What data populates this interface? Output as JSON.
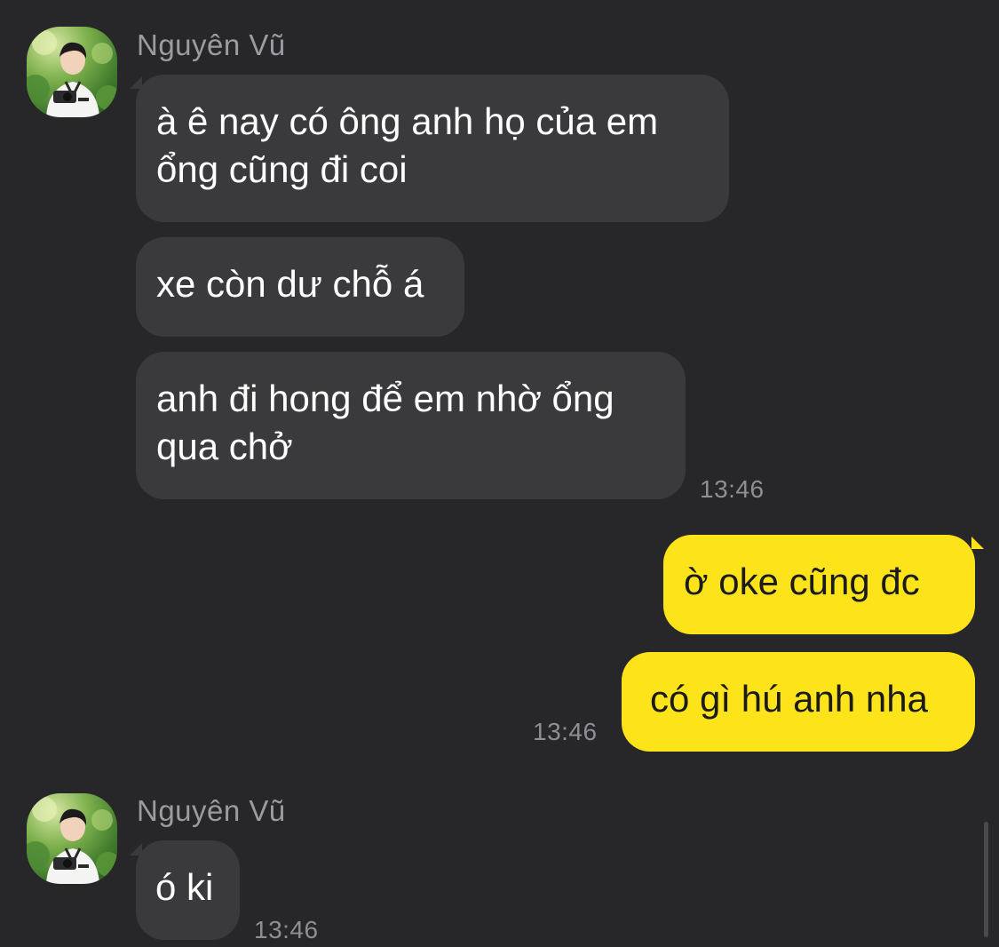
{
  "colors": {
    "background": "#272729",
    "incoming_bubble": "#3a3a3c",
    "outgoing_bubble": "#fce31a",
    "name_text": "#9b9ba0",
    "time_text": "#8e8e93"
  },
  "groups": [
    {
      "sender": "Nguyên Vũ",
      "avatar_icon": "profile-photo",
      "messages": [
        "à ê nay có ông anh họ của em\nổng cũng đi coi",
        "xe còn dư chỗ á",
        "anh đi hong để em nhờ ổng\nqua chở"
      ],
      "time": "13:46"
    },
    {
      "sender": "me",
      "messages": [
        "ờ oke cũng đc",
        "có gì hú anh nha"
      ],
      "time": "13:46"
    },
    {
      "sender": "Nguyên Vũ",
      "avatar_icon": "profile-photo",
      "messages": [
        "ó ki"
      ],
      "time": "13:46"
    }
  ]
}
